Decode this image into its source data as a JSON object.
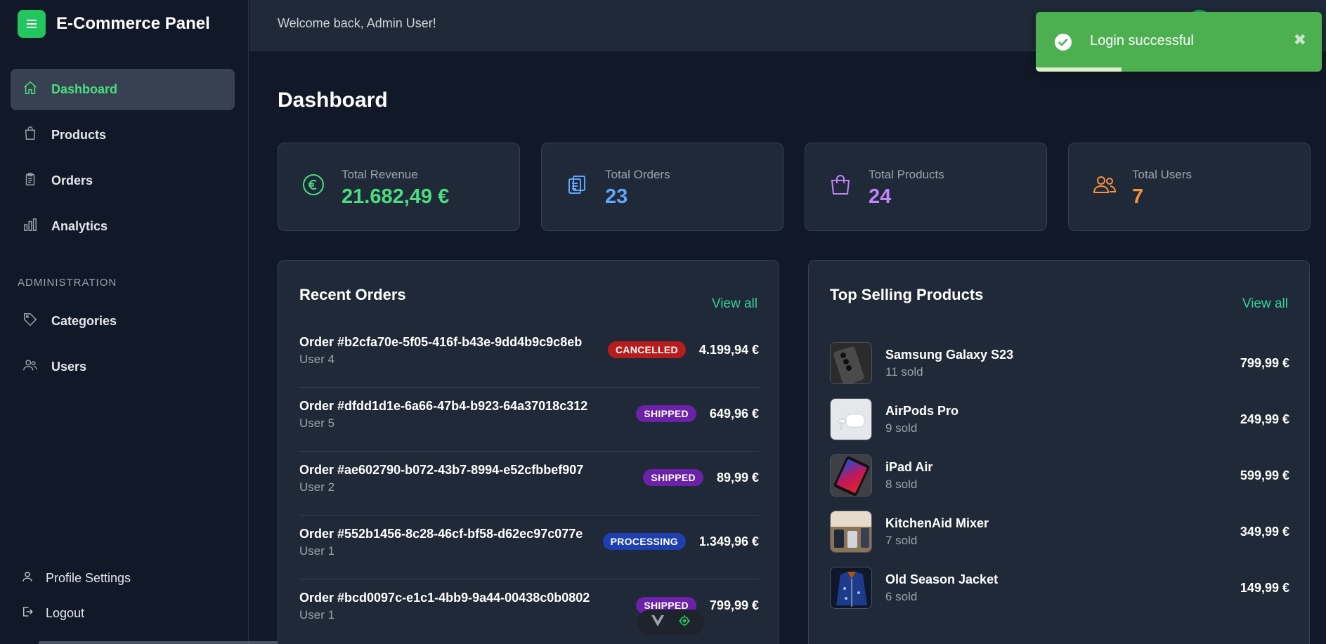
{
  "brand": {
    "title": "E-Commerce Panel",
    "accent": "#22c55e"
  },
  "sidebar": {
    "items": [
      {
        "label": "Dashboard",
        "icon": "home-icon",
        "active": true
      },
      {
        "label": "Products",
        "icon": "shopping-bag-icon"
      },
      {
        "label": "Orders",
        "icon": "clipboard-icon"
      },
      {
        "label": "Analytics",
        "icon": "bar-chart-icon"
      }
    ],
    "section_label": "ADMINISTRATION",
    "admin_items": [
      {
        "label": "Categories",
        "icon": "tag-icon"
      },
      {
        "label": "Users",
        "icon": "users-icon"
      }
    ],
    "bottom_items": [
      {
        "label": "Profile Settings",
        "icon": "user-icon"
      },
      {
        "label": "Logout",
        "icon": "logout-icon"
      }
    ]
  },
  "header": {
    "welcome": "Welcome back, Admin User!"
  },
  "toast": {
    "message": "Login successful",
    "close": "✖",
    "progress_percent": 30,
    "color": "#4caf50"
  },
  "main": {
    "title": "Dashboard",
    "stats": [
      {
        "label": "Total Revenue",
        "value": "21.682,49 €",
        "icon": "euro-icon",
        "color": "#4ade80"
      },
      {
        "label": "Total Orders",
        "value": "23",
        "icon": "clipboard-icon",
        "color": "#60a5fa"
      },
      {
        "label": "Total Products",
        "value": "24",
        "icon": "shopping-bag-icon",
        "color": "#c084fc"
      },
      {
        "label": "Total Users",
        "value": "7",
        "icon": "users-icon",
        "color": "#fb923c"
      }
    ],
    "recent_orders": {
      "title": "Recent Orders",
      "view_all": "View all",
      "rows": [
        {
          "id": "Order #b2cfa70e-5f05-416f-b43e-9dd4b9c9c8eb",
          "user": "User 4",
          "status": "CANCELLED",
          "status_color": "#b91c1c",
          "amount": "4.199,94 €"
        },
        {
          "id": "Order #dfdd1d1e-6a66-47b4-b923-64a37018c312",
          "user": "User 5",
          "status": "SHIPPED",
          "status_color": "#6b21a8",
          "amount": "649,96 €"
        },
        {
          "id": "Order #ae602790-b072-43b7-8994-e52cfbbef907",
          "user": "User 2",
          "status": "SHIPPED",
          "status_color": "#6b21a8",
          "amount": "89,99 €"
        },
        {
          "id": "Order #552b1456-8c28-46cf-bf58-d62ec97c077e",
          "user": "User 1",
          "status": "PROCESSING",
          "status_color": "#1e40af",
          "amount": "1.349,96 €"
        },
        {
          "id": "Order #bcd0097c-e1c1-4bb9-9a44-00438c0b0802",
          "user": "User 1",
          "status": "SHIPPED",
          "status_color": "#6b21a8",
          "amount": "799,99 €"
        }
      ]
    },
    "top_products": {
      "title": "Top Selling Products",
      "view_all": "View all",
      "rows": [
        {
          "name": "Samsung Galaxy S23",
          "sold": "11 sold",
          "price": "799,99 €",
          "thumb": "phone-image"
        },
        {
          "name": "AirPods Pro",
          "sold": "9 sold",
          "price": "249,99 €",
          "thumb": "earbuds-image"
        },
        {
          "name": "iPad Air",
          "sold": "8 sold",
          "price": "599,99 €",
          "thumb": "tablet-image"
        },
        {
          "name": "KitchenAid Mixer",
          "sold": "7 sold",
          "price": "349,99 €",
          "thumb": "mixer-image"
        },
        {
          "name": "Old Season Jacket",
          "sold": "6 sold",
          "price": "149,99 €",
          "thumb": "jacket-image"
        }
      ]
    }
  }
}
